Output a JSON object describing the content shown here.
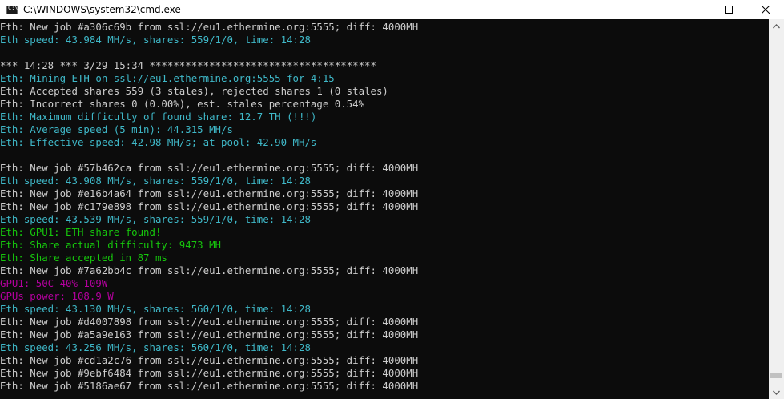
{
  "window": {
    "title": "C:\\WINDOWS\\system32\\cmd.exe",
    "icon": "cmd-icon",
    "icon_glyph": "C:\\"
  },
  "controls": {
    "minimize_icon": "minimize-icon",
    "maximize_icon": "maximize-icon",
    "close_icon": "close-icon"
  },
  "colors": {
    "background": "#0c0c0c",
    "default_text": "#cccccc",
    "cyan": "#3fb8c8",
    "green": "#16c60c",
    "magenta": "#b4009e"
  },
  "console_lines": [
    {
      "text": "Eth: New job #a306c69b from ssl://eu1.ethermine.org:5555; diff: 4000MH",
      "color": "white"
    },
    {
      "text": "Eth speed: 43.984 MH/s, shares: 559/1/0, time: 14:28",
      "color": "cyan"
    },
    {
      "text": "",
      "color": "white"
    },
    {
      "text": "*** 14:28 *** 3/29 15:34 **************************************",
      "color": "white"
    },
    {
      "text": "Eth: Mining ETH on ssl://eu1.ethermine.org:5555 for 4:15",
      "color": "cyan"
    },
    {
      "text": "Eth: Accepted shares 559 (3 stales), rejected shares 1 (0 stales)",
      "color": "white"
    },
    {
      "text": "Eth: Incorrect shares 0 (0.00%), est. stales percentage 0.54%",
      "color": "white"
    },
    {
      "text": "Eth: Maximum difficulty of found share: 12.7 TH (!!!)",
      "color": "cyan"
    },
    {
      "text": "Eth: Average speed (5 min): 44.315 MH/s",
      "color": "cyan"
    },
    {
      "text": "Eth: Effective speed: 42.98 MH/s; at pool: 42.90 MH/s",
      "color": "cyan"
    },
    {
      "text": "",
      "color": "white"
    },
    {
      "text": "Eth: New job #57b462ca from ssl://eu1.ethermine.org:5555; diff: 4000MH",
      "color": "white"
    },
    {
      "text": "Eth speed: 43.908 MH/s, shares: 559/1/0, time: 14:28",
      "color": "cyan"
    },
    {
      "text": "Eth: New job #e16b4a64 from ssl://eu1.ethermine.org:5555; diff: 4000MH",
      "color": "white"
    },
    {
      "text": "Eth: New job #c179e898 from ssl://eu1.ethermine.org:5555; diff: 4000MH",
      "color": "white"
    },
    {
      "text": "Eth speed: 43.539 MH/s, shares: 559/1/0, time: 14:28",
      "color": "cyan"
    },
    {
      "text": "Eth: GPU1: ETH share found!",
      "color": "green"
    },
    {
      "text": "Eth: Share actual difficulty: 9473 MH",
      "color": "green"
    },
    {
      "text": "Eth: Share accepted in 87 ms",
      "color": "green"
    },
    {
      "text": "Eth: New job #7a62bb4c from ssl://eu1.ethermine.org:5555; diff: 4000MH",
      "color": "white"
    },
    {
      "text": "GPU1: 50C 40% 109W",
      "color": "magenta"
    },
    {
      "text": "GPUs power: 108.9 W",
      "color": "magenta"
    },
    {
      "text": "Eth speed: 43.130 MH/s, shares: 560/1/0, time: 14:28",
      "color": "cyan"
    },
    {
      "text": "Eth: New job #d4007898 from ssl://eu1.ethermine.org:5555; diff: 4000MH",
      "color": "white"
    },
    {
      "text": "Eth: New job #a5a9e163 from ssl://eu1.ethermine.org:5555; diff: 4000MH",
      "color": "white"
    },
    {
      "text": "Eth speed: 43.256 MH/s, shares: 560/1/0, time: 14:28",
      "color": "cyan"
    },
    {
      "text": "Eth: New job #cd1a2c76 from ssl://eu1.ethermine.org:5555; diff: 4000MH",
      "color": "white"
    },
    {
      "text": "Eth: New job #9ebf6484 from ssl://eu1.ethermine.org:5555; diff: 4000MH",
      "color": "white"
    },
    {
      "text": "Eth: New job #5186ae67 from ssl://eu1.ethermine.org:5555; diff: 4000MH",
      "color": "white"
    }
  ],
  "scrollbar": {
    "up_icon": "scroll-up-arrow-icon",
    "down_icon": "scroll-down-arrow-icon",
    "position_percent": 98
  }
}
